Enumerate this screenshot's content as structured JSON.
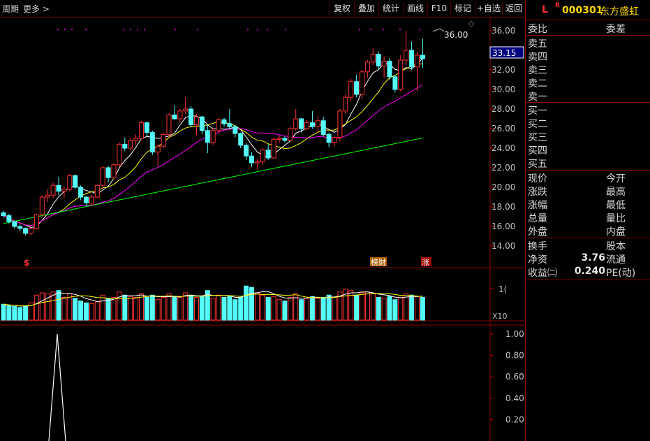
{
  "toolbar": {
    "period_label": "周期",
    "more_label": "更多 >",
    "buttons": [
      "复权",
      "叠加",
      "统计",
      "画线",
      "F10",
      "标记",
      "+自选",
      "返回"
    ]
  },
  "stock": {
    "market_flag": "L",
    "badge": "R",
    "code": "000301",
    "name": "东方盛虹"
  },
  "order_book": {
    "ratio_label": "委比",
    "diff_label": "委差",
    "sell_levels": [
      "卖五",
      "卖四",
      "卖三",
      "卖二",
      "卖一"
    ],
    "buy_levels": [
      "买一",
      "买二",
      "买三",
      "买四",
      "买五"
    ]
  },
  "quote": {
    "left_labels": [
      "现价",
      "涨跌",
      "涨幅",
      "总量",
      "外盘"
    ],
    "right_labels": [
      "今开",
      "最高",
      "最低",
      "量比",
      "内盘"
    ]
  },
  "fundamentals": {
    "turnover_label": "换手",
    "capital_label": "股本",
    "net_asset_label": "净资",
    "net_asset_value": "3.76",
    "float_label": "流通",
    "eps_label": "收益㈡",
    "eps_value": "0.240",
    "pe_label": "PE(动)"
  },
  "chart_data": {
    "type": "candlestick",
    "price_axis": {
      "min": 14,
      "max": 36,
      "ticks": [
        "36.00",
        "34.00",
        "32.00",
        "30.00",
        "28.00",
        "26.00",
        "24.00",
        "22.00",
        "20.00",
        "18.00",
        "16.00",
        "14.00"
      ]
    },
    "current_price_label": "33.15",
    "current_price": 33.15,
    "peak_label": "36.00",
    "peak_value": 36.0,
    "markers": [
      {
        "text": "$",
        "color": "#ff3030"
      },
      {
        "text": "榜财",
        "color": "#ffffff"
      },
      {
        "text": "涨",
        "color": "#ffffff"
      }
    ],
    "volume_axis_label": "1(",
    "volume_unit_label": "X10",
    "indicator_axis": {
      "min": 0,
      "max": 1.0,
      "ticks": [
        "1.00",
        "0.80",
        "0.60",
        "0.40",
        "0.20"
      ]
    },
    "candles": [
      [
        17.4,
        17.6,
        16.9,
        17.1
      ],
      [
        17.1,
        17.3,
        16.3,
        16.5
      ],
      [
        16.5,
        16.6,
        15.8,
        16.0
      ],
      [
        16.0,
        16.2,
        15.5,
        15.8
      ],
      [
        15.8,
        15.9,
        15.1,
        15.3
      ],
      [
        15.3,
        16.0,
        15.1,
        15.8
      ],
      [
        15.8,
        17.3,
        15.7,
        17.2
      ],
      [
        17.2,
        19.2,
        17.0,
        19.0
      ],
      [
        19.0,
        19.8,
        18.5,
        19.2
      ],
      [
        19.2,
        20.5,
        18.9,
        20.2
      ],
      [
        20.2,
        21.1,
        19.2,
        19.6
      ],
      [
        19.6,
        20.1,
        18.9,
        19.8
      ],
      [
        19.8,
        21.4,
        19.6,
        21.2
      ],
      [
        21.2,
        21.3,
        19.8,
        20.0
      ],
      [
        20.0,
        20.2,
        18.7,
        19.0
      ],
      [
        19.0,
        19.1,
        18.1,
        18.4
      ],
      [
        18.4,
        19.2,
        18.2,
        19.0
      ],
      [
        19.0,
        20.3,
        18.9,
        20.2
      ],
      [
        20.2,
        22.2,
        20.0,
        22.0
      ],
      [
        22.0,
        22.2,
        20.5,
        21.0
      ],
      [
        21.0,
        22.5,
        20.8,
        22.3
      ],
      [
        22.3,
        24.6,
        22.1,
        24.4
      ],
      [
        24.4,
        25.1,
        23.7,
        24.0
      ],
      [
        24.0,
        25.0,
        23.8,
        24.8
      ],
      [
        24.8,
        25.4,
        24.3,
        25.0
      ],
      [
        25.0,
        26.8,
        24.9,
        26.6
      ],
      [
        26.6,
        26.7,
        25.2,
        25.6
      ],
      [
        25.6,
        25.8,
        23.3,
        23.6
      ],
      [
        23.6,
        24.4,
        22.2,
        24.2
      ],
      [
        24.2,
        25.6,
        24.0,
        25.4
      ],
      [
        25.4,
        27.6,
        25.2,
        27.4
      ],
      [
        27.4,
        28.4,
        26.9,
        27.0
      ],
      [
        27.0,
        28.0,
        26.6,
        27.8
      ],
      [
        27.8,
        29.2,
        27.5,
        28.0
      ],
      [
        28.0,
        28.3,
        26.1,
        26.4
      ],
      [
        26.4,
        27.5,
        25.3,
        27.2
      ],
      [
        27.2,
        27.3,
        25.4,
        25.8
      ],
      [
        25.8,
        26.5,
        23.5,
        24.6
      ],
      [
        24.6,
        26.1,
        24.3,
        25.8
      ],
      [
        25.8,
        27.1,
        25.6,
        26.9
      ],
      [
        26.9,
        27.1,
        26.2,
        26.5
      ],
      [
        26.5,
        28.0,
        25.9,
        26.2
      ],
      [
        26.2,
        26.4,
        25.1,
        25.5
      ],
      [
        25.5,
        25.6,
        24.0,
        24.3
      ],
      [
        24.3,
        24.5,
        22.8,
        23.2
      ],
      [
        23.2,
        23.6,
        22.1,
        22.5
      ],
      [
        22.5,
        22.9,
        21.8,
        22.6
      ],
      [
        22.6,
        24.0,
        22.3,
        23.8
      ],
      [
        23.8,
        24.4,
        22.8,
        23.0
      ],
      [
        23.0,
        25.1,
        22.9,
        24.9
      ],
      [
        24.9,
        25.3,
        24.5,
        25.0
      ],
      [
        25.0,
        25.2,
        24.6,
        24.8
      ],
      [
        24.8,
        26.2,
        24.7,
        26.0
      ],
      [
        26.0,
        28.0,
        25.8,
        27.0
      ],
      [
        27.0,
        27.1,
        25.6,
        26.0
      ],
      [
        26.0,
        26.9,
        25.8,
        26.6
      ],
      [
        26.6,
        27.8,
        26.0,
        26.2
      ],
      [
        26.2,
        27.3,
        25.5,
        26.8
      ],
      [
        26.8,
        27.2,
        25.2,
        25.4
      ],
      [
        25.4,
        25.6,
        24.1,
        24.6
      ],
      [
        24.6,
        25.3,
        24.2,
        25.1
      ],
      [
        25.1,
        28.0,
        24.7,
        27.8
      ],
      [
        27.8,
        29.5,
        27.5,
        29.2
      ],
      [
        29.2,
        31.1,
        28.9,
        30.8
      ],
      [
        30.8,
        31.5,
        29.2,
        29.5
      ],
      [
        29.5,
        32.0,
        29.0,
        31.8
      ],
      [
        31.8,
        33.0,
        31.2,
        32.8
      ],
      [
        32.8,
        34.2,
        32.5,
        33.6
      ],
      [
        33.6,
        33.9,
        32.0,
        32.4
      ],
      [
        32.4,
        33.4,
        31.2,
        32.9
      ],
      [
        32.9,
        33.2,
        31.0,
        31.3
      ],
      [
        31.3,
        31.5,
        29.7,
        30.0
      ],
      [
        30.0,
        33.5,
        29.8,
        33.0
      ],
      [
        33.0,
        36.0,
        32.5,
        34.0
      ],
      [
        34.0,
        34.9,
        32.0,
        32.3
      ],
      [
        32.3,
        33.8,
        29.8,
        33.5
      ],
      [
        33.5,
        35.2,
        32.2,
        33.15
      ]
    ],
    "volumes": [
      35,
      32,
      30,
      28,
      31,
      38,
      55,
      60,
      58,
      62,
      65,
      50,
      58,
      48,
      42,
      38,
      36,
      40,
      55,
      48,
      50,
      62,
      55,
      52,
      50,
      58,
      50,
      55,
      45,
      50,
      58,
      52,
      50,
      60,
      55,
      50,
      52,
      65,
      48,
      55,
      50,
      52,
      45,
      50,
      75,
      72,
      60,
      55,
      50,
      52,
      45,
      42,
      50,
      58,
      45,
      48,
      52,
      48,
      50,
      55,
      50,
      62,
      68,
      65,
      55,
      60,
      62,
      58,
      50,
      48,
      52,
      45,
      50,
      58,
      55,
      52,
      50
    ],
    "volume_max": 100
  }
}
